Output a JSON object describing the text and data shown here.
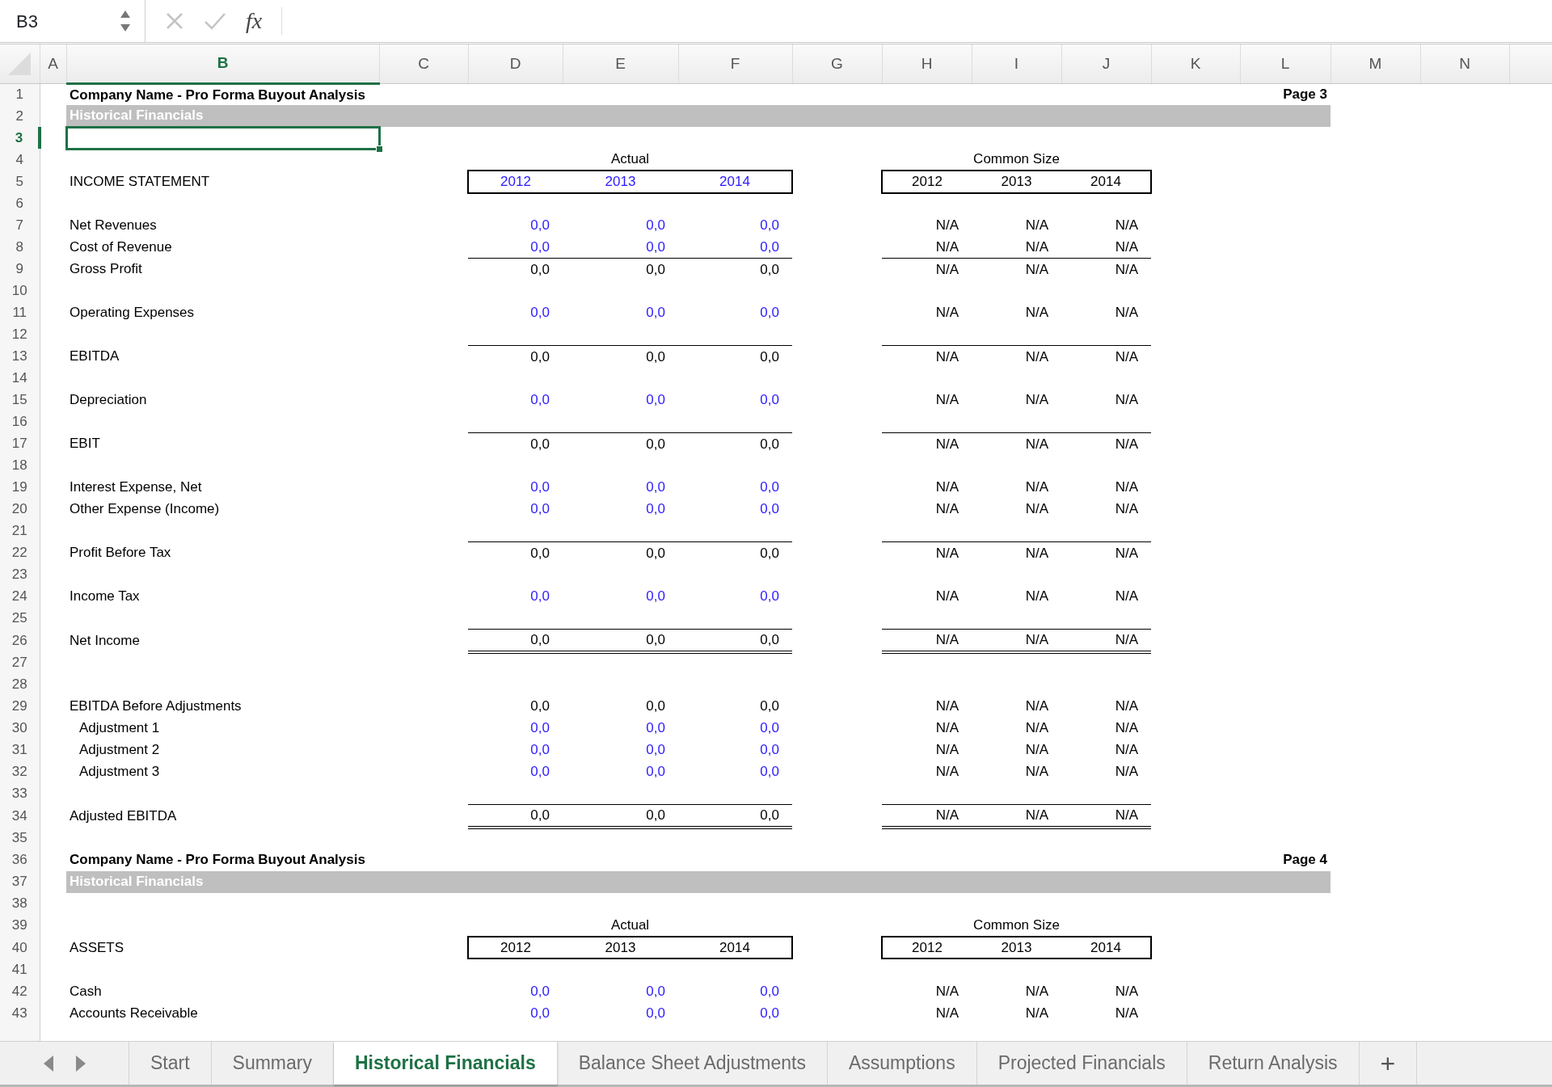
{
  "formula_bar": {
    "name_box": "B3",
    "fx": "fx"
  },
  "columns": [
    {
      "letter": "A",
      "selected": false
    },
    {
      "letter": "B",
      "selected": true
    },
    {
      "letter": "C",
      "selected": false
    },
    {
      "letter": "D",
      "selected": false
    },
    {
      "letter": "E",
      "selected": false
    },
    {
      "letter": "F",
      "selected": false
    },
    {
      "letter": "G",
      "selected": false
    },
    {
      "letter": "H",
      "selected": false
    },
    {
      "letter": "I",
      "selected": false
    },
    {
      "letter": "J",
      "selected": false
    },
    {
      "letter": "K",
      "selected": false
    },
    {
      "letter": "L",
      "selected": false
    },
    {
      "letter": "M",
      "selected": false
    },
    {
      "letter": "N",
      "selected": false
    }
  ],
  "rows": [
    {
      "number": "1",
      "selected": false,
      "kind": "title",
      "title": "Company Name - Pro Forma Buyout Analysis",
      "page": "Page 3"
    },
    {
      "number": "2",
      "selected": false,
      "kind": "band",
      "label": "Historical Financials"
    },
    {
      "number": "3",
      "selected": true,
      "kind": "blank"
    },
    {
      "number": "4",
      "selected": false,
      "kind": "group_heads",
      "actual": "Actual",
      "common": "Common Size"
    },
    {
      "number": "5",
      "selected": false,
      "kind": "years",
      "label": "INCOME STATEMENT",
      "input": true,
      "actual": [
        "2012",
        "2013",
        "2014"
      ],
      "common": [
        "2012",
        "2013",
        "2014"
      ]
    },
    {
      "number": "6",
      "selected": false,
      "kind": "blank"
    },
    {
      "number": "7",
      "selected": false,
      "kind": "line",
      "label": "Net Revenues",
      "input": true,
      "indent": false,
      "rule_above": false,
      "double_rule_below": false,
      "actual": [
        "0,0",
        "0,0",
        "0,0"
      ],
      "common": [
        "N/A",
        "N/A",
        "N/A"
      ]
    },
    {
      "number": "8",
      "selected": false,
      "kind": "line",
      "label": "Cost of Revenue",
      "input": true,
      "indent": false,
      "rule_above": false,
      "double_rule_below": false,
      "actual": [
        "0,0",
        "0,0",
        "0,0"
      ],
      "common": [
        "N/A",
        "N/A",
        "N/A"
      ]
    },
    {
      "number": "9",
      "selected": false,
      "kind": "line",
      "label": "Gross Profit",
      "input": false,
      "indent": false,
      "rule_above": true,
      "double_rule_below": false,
      "actual": [
        "0,0",
        "0,0",
        "0,0"
      ],
      "common": [
        "N/A",
        "N/A",
        "N/A"
      ]
    },
    {
      "number": "10",
      "selected": false,
      "kind": "blank"
    },
    {
      "number": "11",
      "selected": false,
      "kind": "line",
      "label": "Operating Expenses",
      "input": true,
      "indent": false,
      "rule_above": false,
      "double_rule_below": false,
      "actual": [
        "0,0",
        "0,0",
        "0,0"
      ],
      "common": [
        "N/A",
        "N/A",
        "N/A"
      ]
    },
    {
      "number": "12",
      "selected": false,
      "kind": "blank"
    },
    {
      "number": "13",
      "selected": false,
      "kind": "line",
      "label": "EBITDA",
      "input": false,
      "indent": false,
      "rule_above": true,
      "double_rule_below": false,
      "actual": [
        "0,0",
        "0,0",
        "0,0"
      ],
      "common": [
        "N/A",
        "N/A",
        "N/A"
      ]
    },
    {
      "number": "14",
      "selected": false,
      "kind": "blank"
    },
    {
      "number": "15",
      "selected": false,
      "kind": "line",
      "label": "Depreciation",
      "input": true,
      "indent": false,
      "rule_above": false,
      "double_rule_below": false,
      "actual": [
        "0,0",
        "0,0",
        "0,0"
      ],
      "common": [
        "N/A",
        "N/A",
        "N/A"
      ]
    },
    {
      "number": "16",
      "selected": false,
      "kind": "blank"
    },
    {
      "number": "17",
      "selected": false,
      "kind": "line",
      "label": "EBIT",
      "input": false,
      "indent": false,
      "rule_above": true,
      "double_rule_below": false,
      "actual": [
        "0,0",
        "0,0",
        "0,0"
      ],
      "common": [
        "N/A",
        "N/A",
        "N/A"
      ]
    },
    {
      "number": "18",
      "selected": false,
      "kind": "blank"
    },
    {
      "number": "19",
      "selected": false,
      "kind": "line",
      "label": "Interest Expense, Net",
      "input": true,
      "indent": false,
      "rule_above": false,
      "double_rule_below": false,
      "actual": [
        "0,0",
        "0,0",
        "0,0"
      ],
      "common": [
        "N/A",
        "N/A",
        "N/A"
      ]
    },
    {
      "number": "20",
      "selected": false,
      "kind": "line",
      "label": "Other Expense (Income)",
      "input": true,
      "indent": false,
      "rule_above": false,
      "double_rule_below": false,
      "actual": [
        "0,0",
        "0,0",
        "0,0"
      ],
      "common": [
        "N/A",
        "N/A",
        "N/A"
      ]
    },
    {
      "number": "21",
      "selected": false,
      "kind": "blank"
    },
    {
      "number": "22",
      "selected": false,
      "kind": "line",
      "label": "Profit Before Tax",
      "input": false,
      "indent": false,
      "rule_above": true,
      "double_rule_below": false,
      "actual": [
        "0,0",
        "0,0",
        "0,0"
      ],
      "common": [
        "N/A",
        "N/A",
        "N/A"
      ]
    },
    {
      "number": "23",
      "selected": false,
      "kind": "blank"
    },
    {
      "number": "24",
      "selected": false,
      "kind": "line",
      "label": "Income Tax",
      "input": true,
      "indent": false,
      "rule_above": false,
      "double_rule_below": false,
      "actual": [
        "0,0",
        "0,0",
        "0,0"
      ],
      "common": [
        "N/A",
        "N/A",
        "N/A"
      ]
    },
    {
      "number": "25",
      "selected": false,
      "kind": "blank"
    },
    {
      "number": "26",
      "selected": false,
      "kind": "line",
      "label": "Net Income",
      "input": false,
      "indent": false,
      "rule_above": true,
      "double_rule_below": true,
      "actual": [
        "0,0",
        "0,0",
        "0,0"
      ],
      "common": [
        "N/A",
        "N/A",
        "N/A"
      ]
    },
    {
      "number": "27",
      "selected": false,
      "kind": "blank"
    },
    {
      "number": "28",
      "selected": false,
      "kind": "blank"
    },
    {
      "number": "29",
      "selected": false,
      "kind": "line",
      "label": "EBITDA Before Adjustments",
      "input": false,
      "indent": false,
      "rule_above": false,
      "double_rule_below": false,
      "actual": [
        "0,0",
        "0,0",
        "0,0"
      ],
      "common": [
        "N/A",
        "N/A",
        "N/A"
      ]
    },
    {
      "number": "30",
      "selected": false,
      "kind": "line",
      "label": "Adjustment 1",
      "input": true,
      "indent": true,
      "rule_above": false,
      "double_rule_below": false,
      "actual": [
        "0,0",
        "0,0",
        "0,0"
      ],
      "common": [
        "N/A",
        "N/A",
        "N/A"
      ]
    },
    {
      "number": "31",
      "selected": false,
      "kind": "line",
      "label": "Adjustment 2",
      "input": true,
      "indent": true,
      "rule_above": false,
      "double_rule_below": false,
      "actual": [
        "0,0",
        "0,0",
        "0,0"
      ],
      "common": [
        "N/A",
        "N/A",
        "N/A"
      ]
    },
    {
      "number": "32",
      "selected": false,
      "kind": "line",
      "label": "Adjustment 3",
      "input": true,
      "indent": true,
      "rule_above": false,
      "double_rule_below": false,
      "actual": [
        "0,0",
        "0,0",
        "0,0"
      ],
      "common": [
        "N/A",
        "N/A",
        "N/A"
      ]
    },
    {
      "number": "33",
      "selected": false,
      "kind": "blank"
    },
    {
      "number": "34",
      "selected": false,
      "kind": "line",
      "label": "Adjusted EBITDA",
      "input": false,
      "indent": false,
      "rule_above": true,
      "double_rule_below": true,
      "actual": [
        "0,0",
        "0,0",
        "0,0"
      ],
      "common": [
        "N/A",
        "N/A",
        "N/A"
      ]
    },
    {
      "number": "35",
      "selected": false,
      "kind": "blank"
    },
    {
      "number": "36",
      "selected": false,
      "kind": "title",
      "title": "Company Name - Pro Forma Buyout Analysis",
      "page": "Page 4"
    },
    {
      "number": "37",
      "selected": false,
      "kind": "band",
      "label": "Historical Financials"
    },
    {
      "number": "38",
      "selected": false,
      "kind": "blank"
    },
    {
      "number": "39",
      "selected": false,
      "kind": "group_heads",
      "actual": "Actual",
      "common": "Common Size"
    },
    {
      "number": "40",
      "selected": false,
      "kind": "years",
      "label": "ASSETS",
      "input": false,
      "actual": [
        "2012",
        "2013",
        "2014"
      ],
      "common": [
        "2012",
        "2013",
        "2014"
      ]
    },
    {
      "number": "41",
      "selected": false,
      "kind": "blank"
    },
    {
      "number": "42",
      "selected": false,
      "kind": "line",
      "label": "Cash",
      "input": true,
      "indent": false,
      "rule_above": false,
      "double_rule_below": false,
      "actual": [
        "0,0",
        "0,0",
        "0,0"
      ],
      "common": [
        "N/A",
        "N/A",
        "N/A"
      ]
    },
    {
      "number": "43",
      "selected": false,
      "kind": "line",
      "label": "Accounts Receivable",
      "input": true,
      "indent": false,
      "rule_above": false,
      "double_rule_below": false,
      "actual": [
        "0,0",
        "0,0",
        "0,0"
      ],
      "common": [
        "N/A",
        "N/A",
        "N/A"
      ]
    }
  ],
  "sheet_tabs": [
    {
      "label": "Start",
      "selected": false
    },
    {
      "label": "Summary",
      "selected": false
    },
    {
      "label": "Historical Financials",
      "selected": true
    },
    {
      "label": "Balance Sheet Adjustments",
      "selected": false
    },
    {
      "label": "Assumptions",
      "selected": false
    },
    {
      "label": "Projected Financials",
      "selected": false
    },
    {
      "label": "Return Analysis",
      "selected": false
    }
  ],
  "add_sheet": "+"
}
